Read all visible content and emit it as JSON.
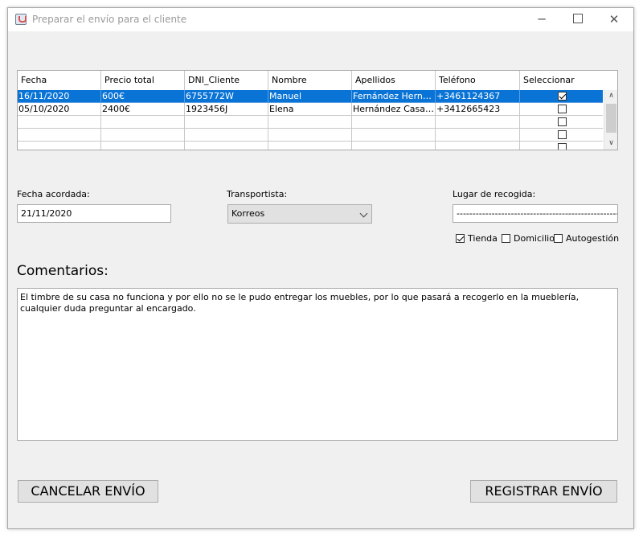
{
  "window": {
    "title": "Preparar el envío para el cliente",
    "minimize_label": "─",
    "close_label": "✕"
  },
  "table": {
    "columns": [
      "Fecha",
      "Precio total",
      "DNI_Cliente",
      "Nombre",
      "Apellidos",
      "Teléfono",
      "Seleccionar"
    ],
    "rows": [
      {
        "fecha": "16/11/2020",
        "precio": "600€",
        "dni": "6755772W",
        "nombre": "Manuel",
        "apellidos": "Fernández Hernández",
        "telefono": "+3461124367",
        "selected": true
      },
      {
        "fecha": "05/10/2020",
        "precio": "2400€",
        "dni": "1923456J",
        "nombre": "Elena",
        "apellidos": "Hernández Casado",
        "telefono": "+3412665423",
        "selected": false
      }
    ],
    "selected_row_index": 0
  },
  "form": {
    "fecha_label": "Fecha acordada:",
    "fecha_value": "21/11/2020",
    "transportista_label": "Transportista:",
    "transportista_value": "Korreos",
    "lugar_label": "Lugar de recogida:",
    "lugar_value": "-------------------------------------------------------",
    "options": [
      {
        "label": "Tienda",
        "checked": true
      },
      {
        "label": "Domicilio",
        "checked": false
      },
      {
        "label": "Autogestión",
        "checked": false
      }
    ]
  },
  "comments": {
    "title": "Comentarios:",
    "text": "El timbre de su casa no funciona y por ello no se le pudo entregar los muebles, por lo que pasará a recogerlo en la mueblería, cualquier duda preguntar al encargado."
  },
  "buttons": {
    "cancel": "CANCELAR ENVÍO",
    "register": "REGISTRAR ENVÍO"
  },
  "colors": {
    "selection": "#0a74d6",
    "window_bg": "#f0f0f0"
  }
}
